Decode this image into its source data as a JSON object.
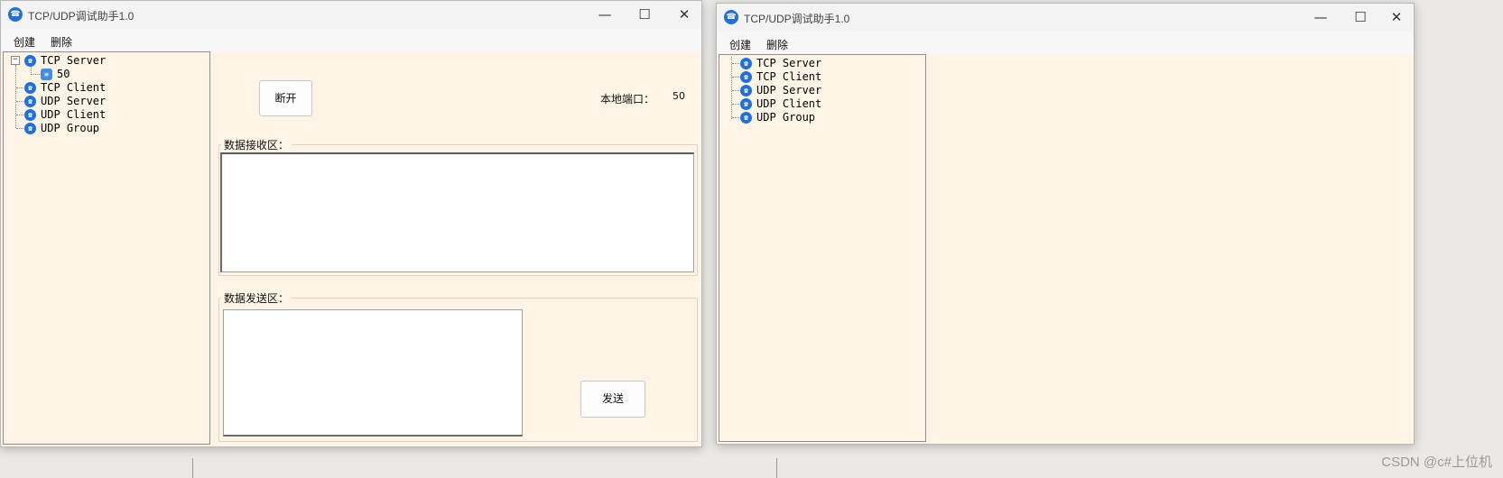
{
  "window1": {
    "title": "TCP/UDP调试助手1.0",
    "menu": [
      "创建",
      "删除"
    ],
    "tree": {
      "root": "TCP Server",
      "child": "50",
      "others": [
        "TCP Client",
        "UDP Server",
        "UDP Client",
        "UDP Group"
      ]
    },
    "disconnect_label": "断开",
    "local_port_label": "本地端口：",
    "local_port_value": "50",
    "receive_group_label": "数据接收区：",
    "send_group_label": "数据发送区：",
    "send_label": "发送"
  },
  "window2": {
    "title": "TCP/UDP调试助手1.0",
    "menu": [
      "创建",
      "删除"
    ],
    "tree": [
      "TCP Server",
      "TCP Client",
      "UDP Server",
      "UDP Client",
      "UDP Group"
    ]
  },
  "watermark": "CSDN @c#上位机",
  "icons": {
    "minimize": "minimize-icon",
    "maximize": "maximize-icon",
    "close": "close-icon",
    "collapse": "chevron-left-icon"
  }
}
